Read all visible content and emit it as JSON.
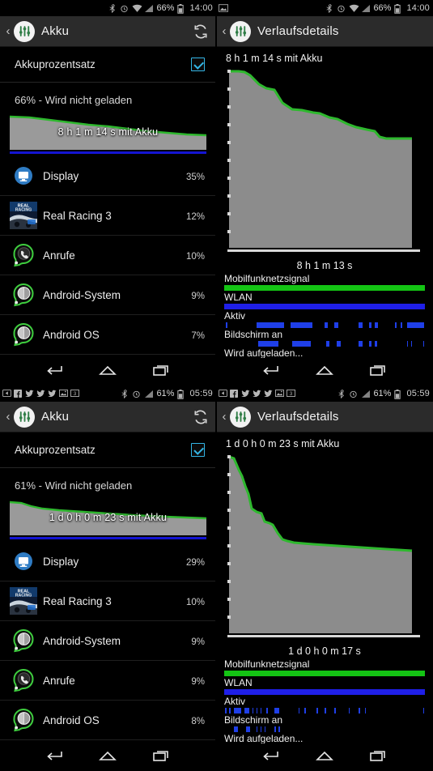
{
  "panels": {
    "top_left": {
      "statusbar": {
        "notif_icons": [],
        "sys_icons": [
          "bluetooth-icon",
          "alarm-icon",
          "wifi-icon",
          "signal-icon"
        ],
        "battery": "66%",
        "time": "14:00"
      },
      "actionbar": {
        "back": "‹",
        "title": "Akku",
        "refresh_icon": "refresh-icon"
      },
      "toggle": {
        "label": "Akkuprozentsatz",
        "checked": true
      },
      "status": "66% - Wird nicht geladen",
      "graph_caption": "8 h 1 m 14 s mit Akku",
      "apps": [
        {
          "name": "Display",
          "pct": "35%",
          "fill": 100,
          "icon": "display-icon"
        },
        {
          "name": "Real Racing 3",
          "pct": "12%",
          "fill": 34,
          "icon": "real-racing-icon"
        },
        {
          "name": "Anrufe",
          "pct": "10%",
          "fill": 30,
          "icon": "phone-icon"
        },
        {
          "name": "Android-System",
          "pct": "9%",
          "fill": 26,
          "icon": "android-system-icon"
        },
        {
          "name": "Android OS",
          "pct": "7%",
          "fill": 22,
          "icon": "android-os-icon"
        }
      ]
    },
    "top_right": {
      "statusbar": {
        "notif_icons": [
          "screenshot-icon"
        ],
        "sys_icons": [
          "bluetooth-icon",
          "alarm-icon",
          "wifi-icon",
          "signal-icon"
        ],
        "battery": "66%",
        "time": "14:00"
      },
      "actionbar": {
        "back": "‹",
        "title": "Verlaufsdetails"
      },
      "chart_title": "8 h 1 m 14 s mit Akku",
      "chart_subtitle": "8 h 1 m 13 s",
      "tracks": [
        {
          "label": "Mobilfunknetzsignal",
          "style": "full-green"
        },
        {
          "label": "WLAN",
          "style": "full-blue"
        },
        {
          "label": "Aktiv",
          "style": "ticks"
        },
        {
          "label": "Bildschirm an",
          "style": "ticks"
        }
      ],
      "tail_label": "Wird aufgeladen..."
    },
    "bottom_left": {
      "statusbar": {
        "notif_icons": [
          "app-icon",
          "facebook-icon",
          "twitter-icon",
          "twitter-icon",
          "twitter-icon",
          "photo-icon",
          "photo-icon"
        ],
        "sys_icons": [
          "bluetooth-icon",
          "alarm-icon",
          "signal-icon"
        ],
        "battery": "61%",
        "time": "05:59"
      },
      "actionbar": {
        "back": "‹",
        "title": "Akku",
        "refresh_icon": "refresh-icon"
      },
      "toggle": {
        "label": "Akkuprozentsatz",
        "checked": true
      },
      "status": "61% - Wird nicht geladen",
      "graph_caption": "1 d 0 h 0 m 23 s mit Akku",
      "apps": [
        {
          "name": "Display",
          "pct": "29%",
          "fill": 100,
          "icon": "display-icon"
        },
        {
          "name": "Real Racing 3",
          "pct": "10%",
          "fill": 34,
          "icon": "real-racing-icon"
        },
        {
          "name": "Android-System",
          "pct": "9%",
          "fill": 32,
          "icon": "android-system-icon"
        },
        {
          "name": "Anrufe",
          "pct": "9%",
          "fill": 30,
          "icon": "phone-icon"
        },
        {
          "name": "Android OS",
          "pct": "8%",
          "fill": 28,
          "icon": "android-os-icon"
        }
      ]
    },
    "bottom_right": {
      "statusbar": {
        "notif_icons": [
          "app-icon",
          "facebook-icon",
          "twitter-icon",
          "twitter-icon",
          "twitter-icon",
          "photo-icon",
          "photo-icon"
        ],
        "sys_icons": [
          "bluetooth-icon",
          "alarm-icon",
          "signal-icon"
        ],
        "battery": "61%",
        "time": "05:59"
      },
      "actionbar": {
        "back": "‹",
        "title": "Verlaufsdetails"
      },
      "chart_title": "1 d 0 h 0 m 23 s mit Akku",
      "chart_subtitle": "1 d 0 h 0 m 17 s",
      "tracks": [
        {
          "label": "Mobilfunknetzsignal",
          "style": "full-green"
        },
        {
          "label": "WLAN",
          "style": "full-blue"
        },
        {
          "label": "Aktiv",
          "style": "ticks"
        },
        {
          "label": "Bildschirm an",
          "style": "ticks"
        }
      ],
      "tail_label": "Wird aufgeladen..."
    }
  },
  "navbar": {
    "back": "back-icon",
    "home": "home-icon",
    "recents": "recents-icon"
  },
  "colors": {
    "accent_blue": "#4a95c8",
    "check_blue": "#33b5e5",
    "graph_green": "#2eb82e",
    "graph_fill": "#8c8c8c",
    "track_green": "#14c414",
    "track_blue": "#1f1fe8",
    "actionbar_bg": "#2b2b2b",
    "bg": "#000000"
  },
  "chart_data": [
    {
      "id": "top-right-battery-history",
      "type": "area",
      "title": "8 h 1 m 14 s mit Akku",
      "xlabel": "8 h 1 m 13 s",
      "ylabel": "",
      "ylim": [
        0,
        100
      ],
      "grid": false,
      "legend": "none",
      "x": [
        0,
        4,
        10,
        14,
        18,
        22,
        26,
        30,
        34,
        38,
        44,
        50,
        56,
        62,
        68,
        74,
        80,
        86,
        92,
        100
      ],
      "y": [
        100,
        99,
        98,
        93,
        90,
        89,
        80,
        79,
        78,
        77,
        74,
        73,
        71,
        70,
        68,
        67,
        66,
        62,
        61,
        61
      ],
      "series": [
        {
          "name": "Akkustand",
          "values": [
            100,
            99,
            98,
            93,
            90,
            89,
            80,
            79,
            78,
            77,
            74,
            73,
            71,
            70,
            68,
            67,
            66,
            62,
            61,
            61
          ]
        }
      ]
    },
    {
      "id": "bottom-right-battery-history",
      "type": "area",
      "title": "1 d 0 h 0 m 23 s mit Akku",
      "xlabel": "1 d 0 h 0 m 17 s",
      "ylabel": "",
      "ylim": [
        0,
        100
      ],
      "grid": false,
      "legend": "none",
      "x": [
        0,
        2,
        5,
        8,
        11,
        13,
        16,
        19,
        22,
        25,
        28,
        40,
        55,
        70,
        85,
        100
      ],
      "y": [
        100,
        95,
        92,
        84,
        80,
        74,
        72,
        70,
        66,
        64,
        62,
        61,
        60,
        59,
        58,
        57
      ],
      "series": [
        {
          "name": "Akkustand",
          "values": [
            100,
            95,
            92,
            84,
            80,
            74,
            72,
            70,
            66,
            64,
            62,
            61,
            60,
            59,
            58,
            57
          ]
        }
      ]
    },
    {
      "id": "top-left-mini-battery",
      "type": "area",
      "title": "8 h 1 m 14 s mit Akku",
      "x": [
        0,
        10,
        20,
        30,
        40,
        50,
        60,
        70,
        80,
        90,
        100
      ],
      "y": [
        100,
        97,
        92,
        88,
        85,
        82,
        78,
        75,
        72,
        70,
        69
      ],
      "ylim": [
        0,
        100
      ]
    },
    {
      "id": "bottom-left-mini-battery",
      "type": "area",
      "title": "1 d 0 h 0 m 23 s mit Akku",
      "x": [
        0,
        6,
        12,
        20,
        30,
        45,
        60,
        75,
        90,
        100
      ],
      "y": [
        100,
        93,
        86,
        82,
        80,
        78,
        76,
        74,
        72,
        71
      ],
      "ylim": [
        0,
        100
      ]
    }
  ]
}
